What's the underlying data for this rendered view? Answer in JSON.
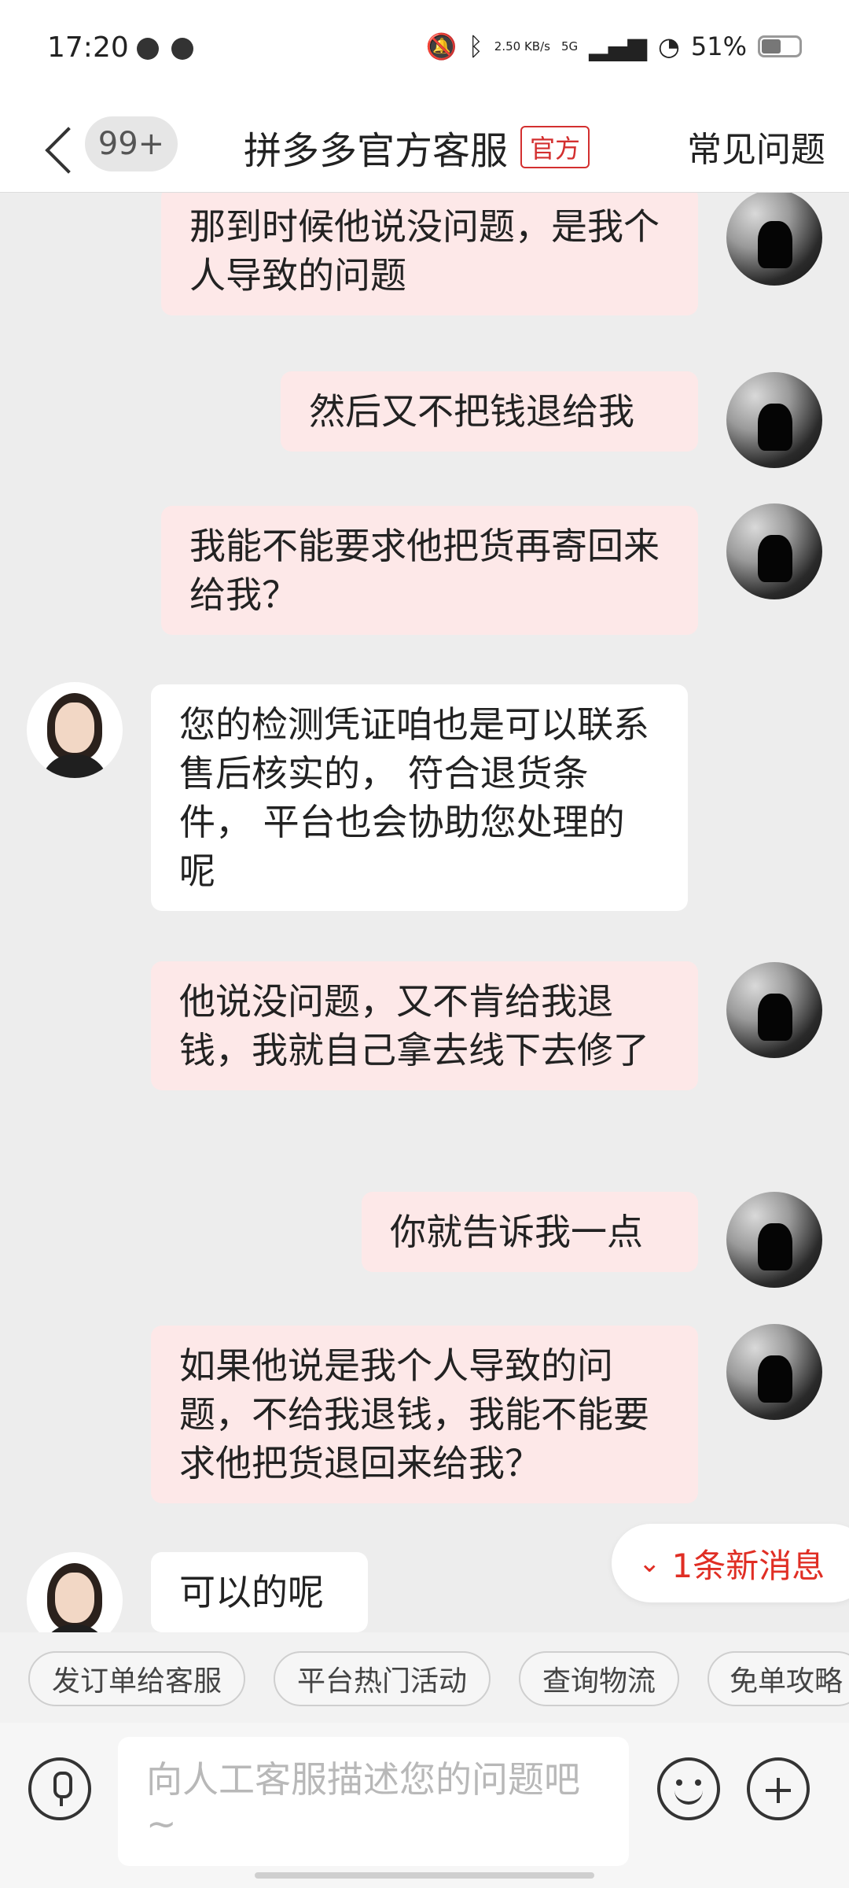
{
  "status_bar": {
    "time": "17:20",
    "network_speed": "2.50 KB/s",
    "signal": "5G",
    "battery": "51%"
  },
  "header": {
    "back_badge": "99+",
    "title": "拼多多官方客服",
    "official_tag": "官方",
    "faq_label": "常见问题"
  },
  "messages": [
    {
      "sender": "user",
      "text": "那到时候他说没问题，是我个人导致的问题"
    },
    {
      "sender": "user",
      "text": "然后又不把钱退给我"
    },
    {
      "sender": "user",
      "text": "我能不能要求他把货再寄回来给我？"
    },
    {
      "sender": "agent",
      "text": "您的检测凭证咱也是可以联系售后核实的， 符合退货条件， 平台也会协助您处理的呢"
    },
    {
      "sender": "user",
      "text": "他说没问题，又不肯给我退钱，我就自己拿去线下去修了"
    },
    {
      "sender": "user",
      "text": "你就告诉我一点"
    },
    {
      "sender": "user",
      "text": "如果他说是我个人导致的问题，不给我退钱，我能不能要求他把货退回来给我？"
    },
    {
      "sender": "agent",
      "text": "可以的呢"
    }
  ],
  "new_message_banner": "1条新消息",
  "quick_replies": [
    "发订单给客服",
    "平台热门活动",
    "查询物流",
    "免单攻略"
  ],
  "input": {
    "placeholder": "向人工客服描述您的问题吧~"
  },
  "colors": {
    "accent": "#e02e24",
    "user_bubble": "#fde8e8",
    "agent_bubble": "#ffffff",
    "background": "#ededed"
  }
}
